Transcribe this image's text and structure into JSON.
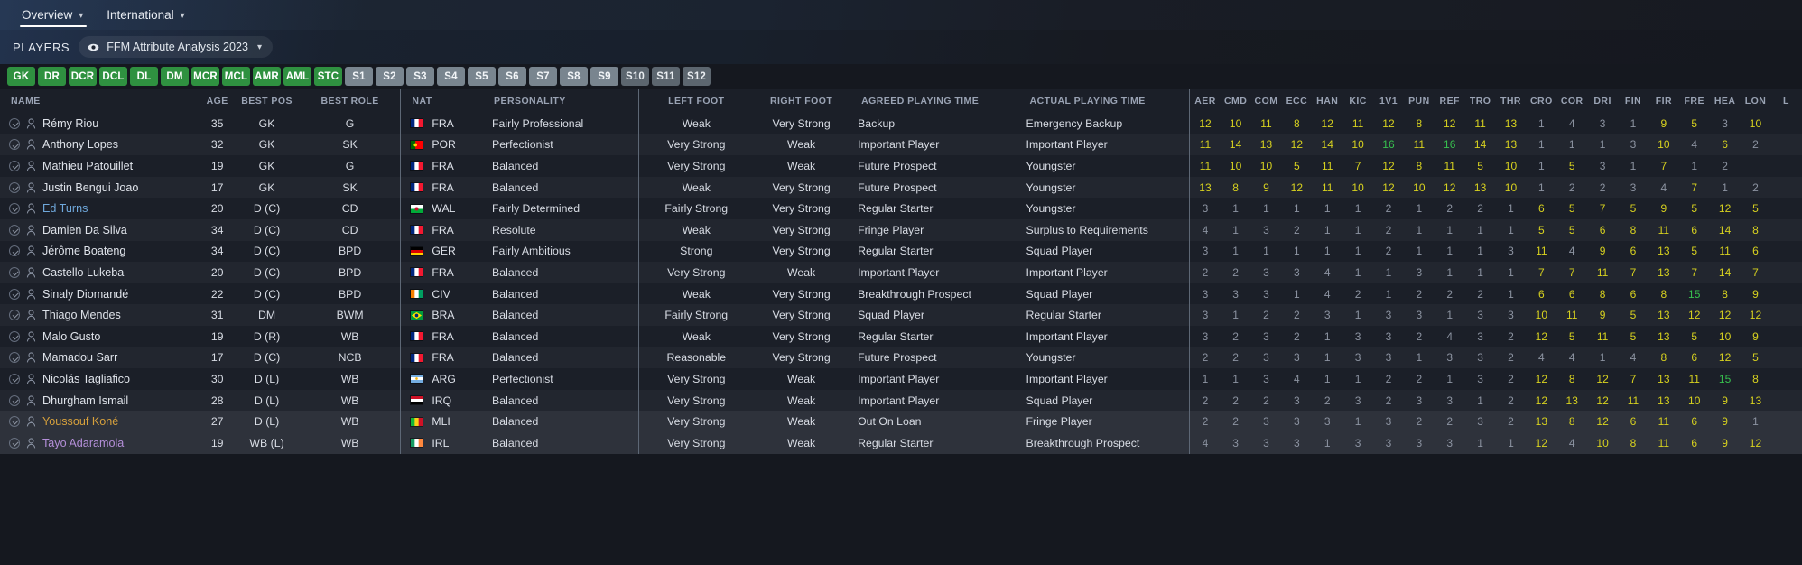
{
  "nav": {
    "tabs": [
      {
        "label": "Overview",
        "active": true,
        "chevron": "chevron-down"
      },
      {
        "label": "International",
        "active": false,
        "chevron": "chevron-down"
      }
    ]
  },
  "playersbar": {
    "label": "PLAYERS",
    "view_pill": {
      "icon": "eye-icon",
      "label": "FFM Attribute Analysis 2023",
      "chevron": "chevron-down"
    }
  },
  "position_filters": {
    "primary": [
      "GK",
      "DR",
      "DCR",
      "DCL",
      "DL",
      "DM",
      "MCR",
      "MCL",
      "AMR",
      "AML",
      "STC"
    ],
    "subs": [
      "S1",
      "S2",
      "S3",
      "S4",
      "S5",
      "S6",
      "S7",
      "S8",
      "S9"
    ],
    "dim": [
      "S10",
      "S11",
      "S12"
    ]
  },
  "colors": {
    "accent_green": "#2f9140",
    "value_high": "#d7d11f",
    "value_top": "#37c04e",
    "value_low": "#8c93a1",
    "background": "#15181f"
  },
  "columns": {
    "left": [
      "NAME",
      "AGE",
      "BEST POS",
      "BEST ROLE"
    ],
    "mid": [
      "NAT",
      "PERSONALITY"
    ],
    "foot": [
      "LEFT FOOT",
      "RIGHT FOOT"
    ],
    "time": [
      "AGREED PLAYING TIME",
      "ACTUAL PLAYING TIME"
    ],
    "attributes": [
      "AER",
      "CMD",
      "COM",
      "ECC",
      "HAN",
      "KIC",
      "1V1",
      "PUN",
      "REF",
      "TRO",
      "THR",
      "CRO",
      "COR",
      "DRI",
      "FIN",
      "FIR",
      "FRE",
      "HEA",
      "LON",
      "L"
    ]
  },
  "rows": [
    {
      "name": "Rémy Riou",
      "name_color": "default",
      "age": "35",
      "best_pos": "GK",
      "best_role": "G",
      "nat": "FRA",
      "flag": "fra",
      "personality": "Fairly Professional",
      "left_foot": "Weak",
      "right_foot": "Very Strong",
      "agreed": "Backup",
      "actual": "Emergency Backup",
      "attrs": [
        "12",
        "10",
        "11",
        "8",
        "12",
        "11",
        "12",
        "8",
        "12",
        "11",
        "13",
        "1",
        "4",
        "3",
        "1",
        "9",
        "5",
        "3",
        "10",
        ""
      ]
    },
    {
      "name": "Anthony Lopes",
      "name_color": "default",
      "age": "32",
      "best_pos": "GK",
      "best_role": "SK",
      "nat": "POR",
      "flag": "por",
      "personality": "Perfectionist",
      "left_foot": "Very Strong",
      "right_foot": "Weak",
      "agreed": "Important Player",
      "actual": "Important Player",
      "attrs": [
        "11",
        "14",
        "13",
        "12",
        "14",
        "10",
        "16",
        "11",
        "16",
        "14",
        "13",
        "1",
        "1",
        "1",
        "3",
        "10",
        "4",
        "6",
        "2",
        ""
      ]
    },
    {
      "name": "Mathieu Patouillet",
      "name_color": "default",
      "age": "19",
      "best_pos": "GK",
      "best_role": "G",
      "nat": "FRA",
      "flag": "fra",
      "personality": "Balanced",
      "left_foot": "Very Strong",
      "right_foot": "Weak",
      "agreed": "Future Prospect",
      "actual": "Youngster",
      "attrs": [
        "11",
        "10",
        "10",
        "5",
        "11",
        "7",
        "12",
        "8",
        "11",
        "5",
        "10",
        "1",
        "5",
        "3",
        "1",
        "7",
        "1",
        "2",
        "",
        ""
      ]
    },
    {
      "name": "Justin Bengui Joao",
      "name_color": "default",
      "age": "17",
      "best_pos": "GK",
      "best_role": "SK",
      "nat": "FRA",
      "flag": "fra",
      "personality": "Balanced",
      "left_foot": "Weak",
      "right_foot": "Very Strong",
      "agreed": "Future Prospect",
      "actual": "Youngster",
      "attrs": [
        "13",
        "8",
        "9",
        "12",
        "11",
        "10",
        "12",
        "10",
        "12",
        "13",
        "10",
        "1",
        "2",
        "2",
        "3",
        "4",
        "7",
        "1",
        "2",
        ""
      ]
    },
    {
      "name": "Ed Turns",
      "name_color": "blue",
      "age": "20",
      "best_pos": "D (C)",
      "best_role": "CD",
      "nat": "WAL",
      "flag": "wal",
      "personality": "Fairly Determined",
      "left_foot": "Fairly Strong",
      "right_foot": "Very Strong",
      "agreed": "Regular Starter",
      "actual": "Youngster",
      "attrs": [
        "3",
        "1",
        "1",
        "1",
        "1",
        "1",
        "2",
        "1",
        "2",
        "2",
        "1",
        "6",
        "5",
        "7",
        "5",
        "9",
        "5",
        "12",
        "5",
        ""
      ]
    },
    {
      "name": "Damien Da Silva",
      "name_color": "default",
      "age": "34",
      "best_pos": "D (C)",
      "best_role": "CD",
      "nat": "FRA",
      "flag": "fra",
      "personality": "Resolute",
      "left_foot": "Weak",
      "right_foot": "Very Strong",
      "agreed": "Fringe Player",
      "actual": "Surplus to Requirements",
      "attrs": [
        "4",
        "1",
        "3",
        "2",
        "1",
        "1",
        "2",
        "1",
        "1",
        "1",
        "1",
        "5",
        "5",
        "6",
        "8",
        "11",
        "6",
        "14",
        "8",
        ""
      ]
    },
    {
      "name": "Jérôme Boateng",
      "name_color": "default",
      "age": "34",
      "best_pos": "D (C)",
      "best_role": "BPD",
      "nat": "GER",
      "flag": "ger",
      "personality": "Fairly Ambitious",
      "left_foot": "Strong",
      "right_foot": "Very Strong",
      "agreed": "Regular Starter",
      "actual": "Squad Player",
      "attrs": [
        "3",
        "1",
        "1",
        "1",
        "1",
        "1",
        "2",
        "1",
        "1",
        "1",
        "3",
        "11",
        "4",
        "9",
        "6",
        "13",
        "5",
        "11",
        "6",
        ""
      ]
    },
    {
      "name": "Castello Lukeba",
      "name_color": "default",
      "age": "20",
      "best_pos": "D (C)",
      "best_role": "BPD",
      "nat": "FRA",
      "flag": "fra",
      "personality": "Balanced",
      "left_foot": "Very Strong",
      "right_foot": "Weak",
      "agreed": "Important Player",
      "actual": "Important Player",
      "attrs": [
        "2",
        "2",
        "3",
        "3",
        "4",
        "1",
        "1",
        "3",
        "1",
        "1",
        "1",
        "7",
        "7",
        "11",
        "7",
        "13",
        "7",
        "14",
        "7",
        ""
      ]
    },
    {
      "name": "Sinaly Diomandé",
      "name_color": "default",
      "age": "22",
      "best_pos": "D (C)",
      "best_role": "BPD",
      "nat": "CIV",
      "flag": "civ",
      "personality": "Balanced",
      "left_foot": "Weak",
      "right_foot": "Very Strong",
      "agreed": "Breakthrough Prospect",
      "actual": "Squad Player",
      "attrs": [
        "3",
        "3",
        "3",
        "1",
        "4",
        "2",
        "1",
        "2",
        "2",
        "2",
        "1",
        "6",
        "6",
        "8",
        "6",
        "8",
        "15",
        "8",
        "9",
        ""
      ]
    },
    {
      "name": "Thiago Mendes",
      "name_color": "default",
      "age": "31",
      "best_pos": "DM",
      "best_role": "BWM",
      "nat": "BRA",
      "flag": "bra",
      "personality": "Balanced",
      "left_foot": "Fairly Strong",
      "right_foot": "Very Strong",
      "agreed": "Squad Player",
      "actual": "Regular Starter",
      "attrs": [
        "3",
        "1",
        "2",
        "2",
        "3",
        "1",
        "3",
        "3",
        "1",
        "3",
        "3",
        "10",
        "11",
        "9",
        "5",
        "13",
        "12",
        "12",
        "12",
        ""
      ]
    },
    {
      "name": "Malo Gusto",
      "name_color": "default",
      "age": "19",
      "best_pos": "D (R)",
      "best_role": "WB",
      "nat": "FRA",
      "flag": "fra",
      "personality": "Balanced",
      "left_foot": "Weak",
      "right_foot": "Very Strong",
      "agreed": "Regular Starter",
      "actual": "Important Player",
      "attrs": [
        "3",
        "2",
        "3",
        "2",
        "1",
        "3",
        "3",
        "2",
        "4",
        "3",
        "2",
        "12",
        "5",
        "11",
        "5",
        "13",
        "5",
        "10",
        "9",
        ""
      ]
    },
    {
      "name": "Mamadou Sarr",
      "name_color": "default",
      "age": "17",
      "best_pos": "D (C)",
      "best_role": "NCB",
      "nat": "FRA",
      "flag": "fra",
      "personality": "Balanced",
      "left_foot": "Reasonable",
      "right_foot": "Very Strong",
      "agreed": "Future Prospect",
      "actual": "Youngster",
      "attrs": [
        "2",
        "2",
        "3",
        "3",
        "1",
        "3",
        "3",
        "1",
        "3",
        "3",
        "2",
        "4",
        "4",
        "1",
        "4",
        "8",
        "6",
        "12",
        "5",
        ""
      ]
    },
    {
      "name": "Nicolás Tagliafico",
      "name_color": "default",
      "age": "30",
      "best_pos": "D (L)",
      "best_role": "WB",
      "nat": "ARG",
      "flag": "arg",
      "personality": "Perfectionist",
      "left_foot": "Very Strong",
      "right_foot": "Weak",
      "agreed": "Important Player",
      "actual": "Important Player",
      "attrs": [
        "1",
        "1",
        "3",
        "4",
        "1",
        "1",
        "2",
        "2",
        "1",
        "3",
        "2",
        "12",
        "8",
        "12",
        "7",
        "13",
        "11",
        "15",
        "8",
        ""
      ]
    },
    {
      "name": "Dhurgham Ismail",
      "name_color": "default",
      "age": "28",
      "best_pos": "D (L)",
      "best_role": "WB",
      "nat": "IRQ",
      "flag": "irq",
      "personality": "Balanced",
      "left_foot": "Very Strong",
      "right_foot": "Weak",
      "agreed": "Important Player",
      "actual": "Squad Player",
      "attrs": [
        "2",
        "2",
        "2",
        "3",
        "2",
        "3",
        "2",
        "3",
        "3",
        "1",
        "2",
        "12",
        "13",
        "12",
        "11",
        "13",
        "10",
        "9",
        "13",
        ""
      ]
    },
    {
      "name": "Youssouf Koné",
      "name_color": "gold",
      "age": "27",
      "best_pos": "D (L)",
      "best_role": "WB",
      "nat": "MLI",
      "flag": "mli",
      "personality": "Balanced",
      "left_foot": "Very Strong",
      "right_foot": "Weak",
      "agreed": "Out On Loan",
      "actual": "Fringe Player",
      "attrs": [
        "2",
        "2",
        "3",
        "3",
        "3",
        "1",
        "3",
        "2",
        "2",
        "3",
        "2",
        "13",
        "8",
        "12",
        "6",
        "11",
        "6",
        "9",
        "1",
        ""
      ]
    },
    {
      "name": "Tayo Adaramola",
      "name_color": "purple",
      "age": "19",
      "best_pos": "WB (L)",
      "best_role": "WB",
      "nat": "IRL",
      "flag": "irl",
      "personality": "Balanced",
      "left_foot": "Very Strong",
      "right_foot": "Weak",
      "agreed": "Regular Starter",
      "actual": "Breakthrough Prospect",
      "attrs": [
        "4",
        "3",
        "3",
        "3",
        "1",
        "3",
        "3",
        "3",
        "3",
        "1",
        "1",
        "12",
        "4",
        "10",
        "8",
        "11",
        "6",
        "9",
        "12",
        ""
      ]
    }
  ]
}
